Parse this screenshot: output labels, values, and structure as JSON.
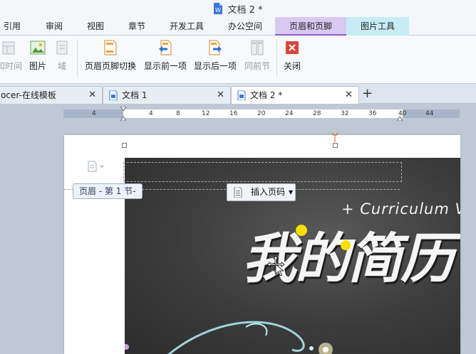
{
  "titlebar": {
    "title": "文档 2 *"
  },
  "menu": {
    "tabs": [
      {
        "label": "引用"
      },
      {
        "label": "审阅"
      },
      {
        "label": "视图"
      },
      {
        "label": "章节"
      },
      {
        "label": "开发工具"
      },
      {
        "label": "办公空间"
      },
      {
        "label": "页眉和页脚"
      },
      {
        "label": "图片工具"
      }
    ]
  },
  "ribbon": {
    "items": [
      {
        "label": "和时间"
      },
      {
        "label": "图片"
      },
      {
        "label": "域"
      },
      {
        "label": "页眉页脚切换"
      },
      {
        "label": "显示前一项"
      },
      {
        "label": "显示后一项"
      },
      {
        "label": "同前节"
      },
      {
        "label": "关闭"
      }
    ]
  },
  "doctabs": {
    "tabs": [
      {
        "label": "ocer-在线模板"
      },
      {
        "label": "文档 1"
      },
      {
        "label": "文档 2 *"
      }
    ]
  },
  "ruler": {
    "ticks": [
      "4",
      "4",
      "8",
      "12",
      "16",
      "20",
      "24",
      "28",
      "32",
      "36",
      "40",
      "44"
    ]
  },
  "page": {
    "header_label": "页眉 - 第 1 节-",
    "insert_page_number": "插入页码",
    "picture_text": "+ Curriculum V",
    "picture_title": "我的简历"
  },
  "colors": {
    "active_tab": "#d9c9f2",
    "picture_tab": "#c8ecf5",
    "close_red": "#d9453c",
    "accent_yellow": "#f6e100"
  }
}
